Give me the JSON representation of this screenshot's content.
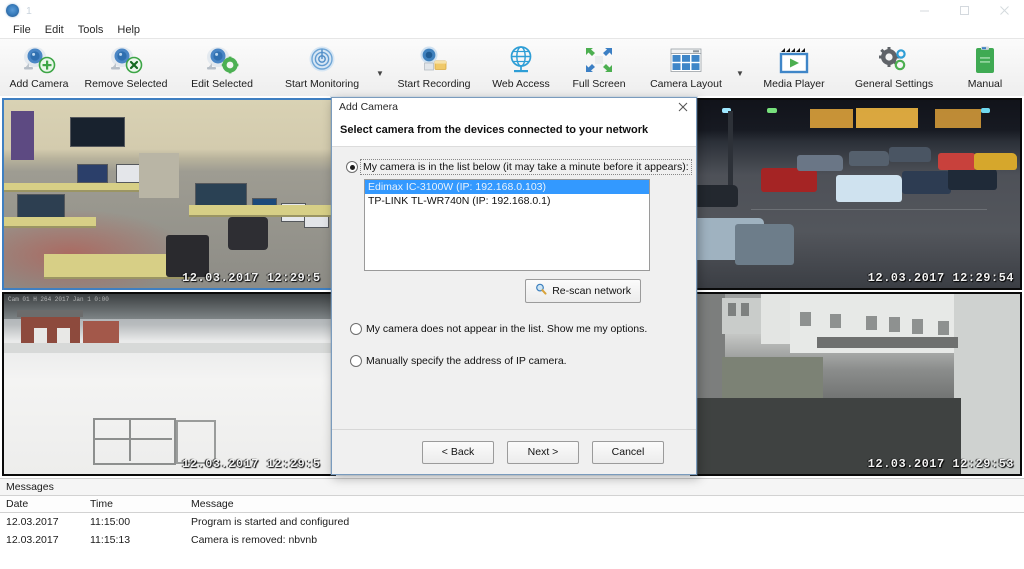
{
  "window": {
    "title": "1",
    "app_icon": "camera-radar-icon",
    "minimize": "minimize-icon",
    "maximize": "maximize-icon",
    "close": "close-icon"
  },
  "menubar": {
    "items": [
      {
        "label": "File"
      },
      {
        "label": "Edit"
      },
      {
        "label": "Tools"
      },
      {
        "label": "Help"
      }
    ]
  },
  "toolbar": {
    "items": [
      {
        "label": "Add Camera",
        "icon": "camera-add-icon",
        "caret": false
      },
      {
        "label": "Remove Selected",
        "icon": "camera-remove-icon",
        "caret": false
      },
      {
        "label": "Edit Selected",
        "icon": "camera-edit-icon",
        "caret": false
      },
      {
        "label": "Start Monitoring",
        "icon": "monitoring-icon",
        "caret": true
      },
      {
        "label": "Start Recording",
        "icon": "record-icon",
        "caret": false
      },
      {
        "label": "Web Access",
        "icon": "globe-icon",
        "caret": false
      },
      {
        "label": "Full Screen",
        "icon": "fullscreen-arrows-icon",
        "caret": false
      },
      {
        "label": "Camera Layout",
        "icon": "grid-layout-icon",
        "caret": true
      },
      {
        "label": "Media Player",
        "icon": "media-player-icon",
        "caret": false
      },
      {
        "label": "General Settings",
        "icon": "gears-icon",
        "caret": false
      },
      {
        "label": "Manual",
        "icon": "manual-book-icon",
        "caret": false
      }
    ]
  },
  "cameras": [
    {
      "id": "cam1",
      "scene": "office-control-room",
      "timestamp": "12.03.2017  12:29:5",
      "selected": true,
      "overlay": ""
    },
    {
      "id": "cam2",
      "scene": "night-parking-lot",
      "timestamp": "12.03.2017 12:29:54",
      "selected": false,
      "overlay": ""
    },
    {
      "id": "cam3",
      "scene": "snowy-farmhouse",
      "timestamp": "12.03.2017 12:29:5",
      "selected": false,
      "overlay": "Cam 01 H 264 2017 Jan 1 0:00"
    },
    {
      "id": "cam4",
      "scene": "grey-courtyard",
      "timestamp": "12.03.2017 12:29:53",
      "selected": false,
      "overlay": ""
    }
  ],
  "messages": {
    "caption": "Messages",
    "columns": [
      "Date",
      "Time",
      "Message"
    ],
    "rows": [
      {
        "date": "12.03.2017",
        "time": "11:15:00",
        "message": "Program is started and configured"
      },
      {
        "date": "12.03.2017",
        "time": "11:15:13",
        "message": "Camera is removed: nbvnb"
      }
    ]
  },
  "dialog": {
    "title": "Add Camera",
    "close_icon": "close-icon",
    "heading": "Select camera from the devices connected to your network",
    "option_list": "My camera is in the list below (it may take a minute before it appears):",
    "devices": [
      {
        "label": "Edimax IC-3100W (IP: 192.168.0.103)",
        "selected": true
      },
      {
        "label": "TP-LINK TL-WR740N (IP: 192.168.0.1)",
        "selected": false
      }
    ],
    "rescan_label": "Re-scan network",
    "rescan_icon": "magnifier-icon",
    "option_not_in_list": "My camera does not appear in the list. Show me my options.",
    "option_manual": "Manually specify the address of IP camera.",
    "buttons": {
      "back": "< Back",
      "next": "Next >",
      "cancel": "Cancel"
    }
  },
  "colors": {
    "accent": "#3399ff",
    "selection_border": "#3f7fc1",
    "ribbon_bg": "#f3f3f3",
    "dialog_bg": "#f0f0f0"
  }
}
